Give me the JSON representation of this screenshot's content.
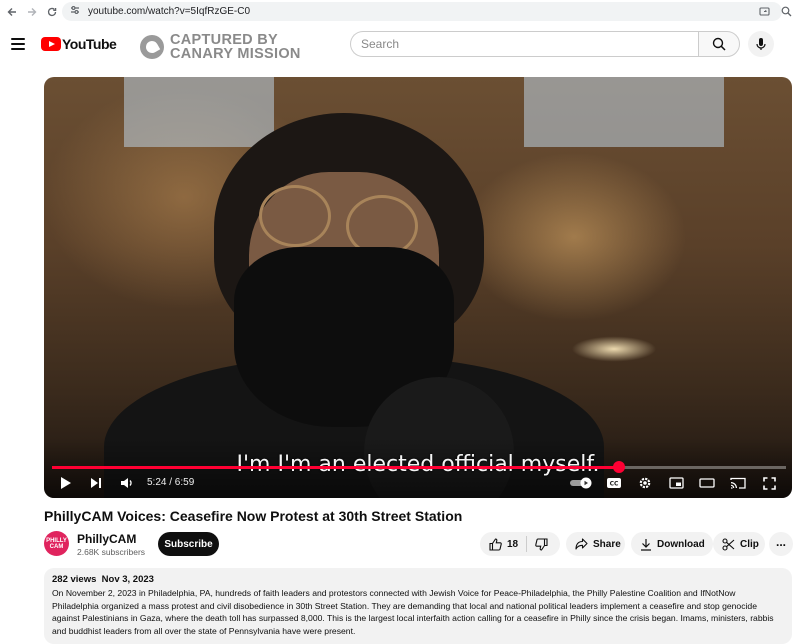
{
  "browser": {
    "url": "youtube.com/watch?v=5IqfRzGE-C0"
  },
  "header": {
    "logo_text": "YouTube",
    "overlay_line1": "CAPTURED BY",
    "overlay_line2": "CANARY MISSION",
    "search_placeholder": "Search"
  },
  "player": {
    "subtitle": "I'm I'm an elected official myself.",
    "current_time": "5:24",
    "duration": "6:59",
    "time_display": "5:24 / 6:59",
    "progress_fraction": 0.773
  },
  "video": {
    "title": "PhillyCAM Voices: Ceasefire Now Protest at 30th Street Station"
  },
  "channel": {
    "name": "PhillyCAM",
    "avatar_line1": "PHILLY",
    "avatar_line2": "CAM",
    "subscribers": "2.68K subscribers",
    "subscribe_label": "Subscribe"
  },
  "actions": {
    "like_count": "18",
    "share_label": "Share",
    "download_label": "Download",
    "clip_label": "Clip",
    "more_label": "..."
  },
  "description": {
    "views": "282 views",
    "date": "Nov 3, 2023",
    "text": "On November 2, 2023 in Philadelphia, PA, hundreds of faith leaders and protestors connected with Jewish Voice for Peace-Philadelphia, the Philly Palestine Coalition and IfNotNow Philadelphia organized a mass protest and civil disobedience in 30th Street Station. They are demanding that local and national political leaders implement a ceasefire and stop genocide against Palestinians in Gaza, where the death toll has surpassed 8,000. This is the largest local interfaith action calling for a ceasefire in Philly since the crisis began. Imams, ministers, rabbis and buddhist leaders from all over the state of Pennsylvania have were present."
  },
  "colors": {
    "brand_red": "#ff0000",
    "progress_red": "#ff0033",
    "avatar_pink": "#e0245e"
  },
  "icons": [
    "back-icon",
    "forward-icon",
    "site-info-icon",
    "cast-tab-icon",
    "zoom-icon",
    "menu-icon",
    "search-icon",
    "mic-icon",
    "play-icon",
    "next-icon",
    "volume-icon",
    "autoplay-icon",
    "captions-icon",
    "settings-icon",
    "miniplayer-icon",
    "theater-icon",
    "cast-icon",
    "fullscreen-icon",
    "like-icon",
    "dislike-icon",
    "share-icon",
    "download-icon",
    "clip-icon",
    "more-icon"
  ]
}
